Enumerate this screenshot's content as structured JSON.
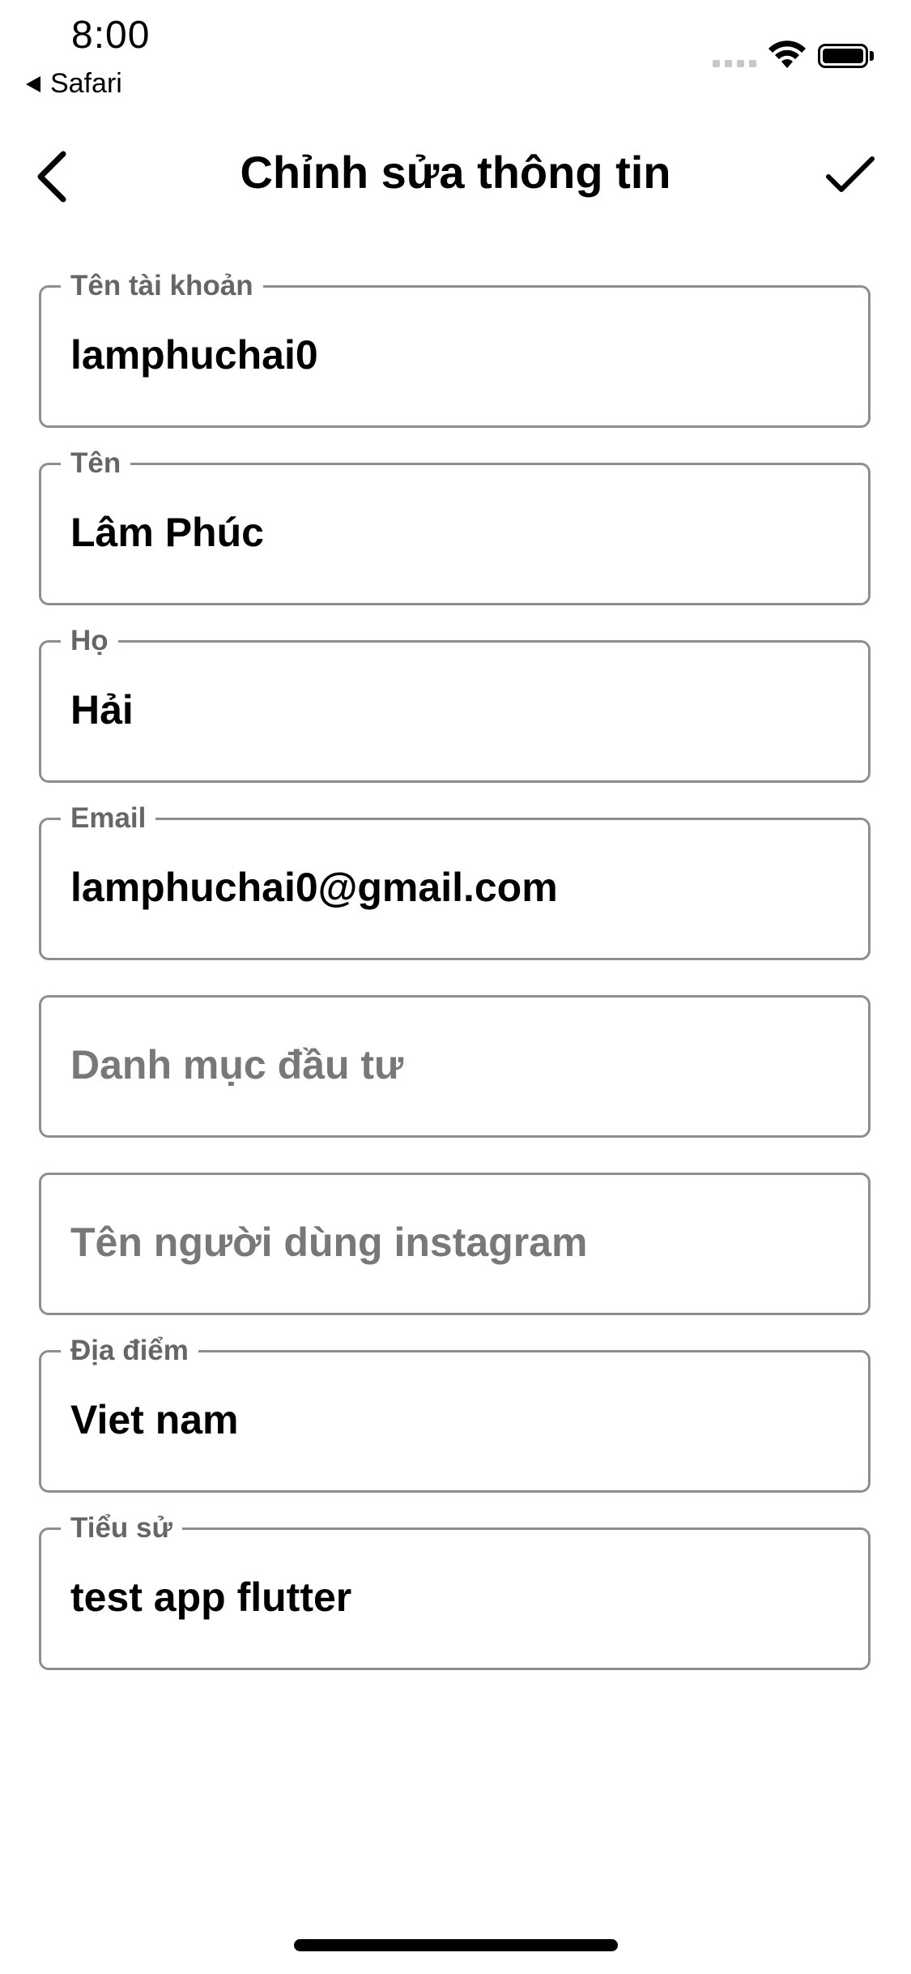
{
  "status_bar": {
    "time": "8:00",
    "back_app": "Safari"
  },
  "nav": {
    "title": "Chỉnh sửa thông tin"
  },
  "form": {
    "fields": [
      {
        "label": "Tên tài khoản",
        "value": "lamphuchai0"
      },
      {
        "label": "Tên",
        "value": "Lâm Phúc"
      },
      {
        "label": "Họ",
        "value": "Hải"
      },
      {
        "label": "Email",
        "value": "lamphuchai0@gmail.com"
      },
      {
        "placeholder": "Danh mục đầu tư"
      },
      {
        "placeholder": "Tên người dùng instagram"
      },
      {
        "label": "Địa điểm",
        "value": "Viet nam"
      },
      {
        "label": "Tiểu sử",
        "value": "test app flutter"
      }
    ]
  },
  "icons": {
    "back": "chevron-left-icon",
    "confirm": "checkmark-icon",
    "wifi": "wifi-icon",
    "battery": "battery-icon"
  }
}
